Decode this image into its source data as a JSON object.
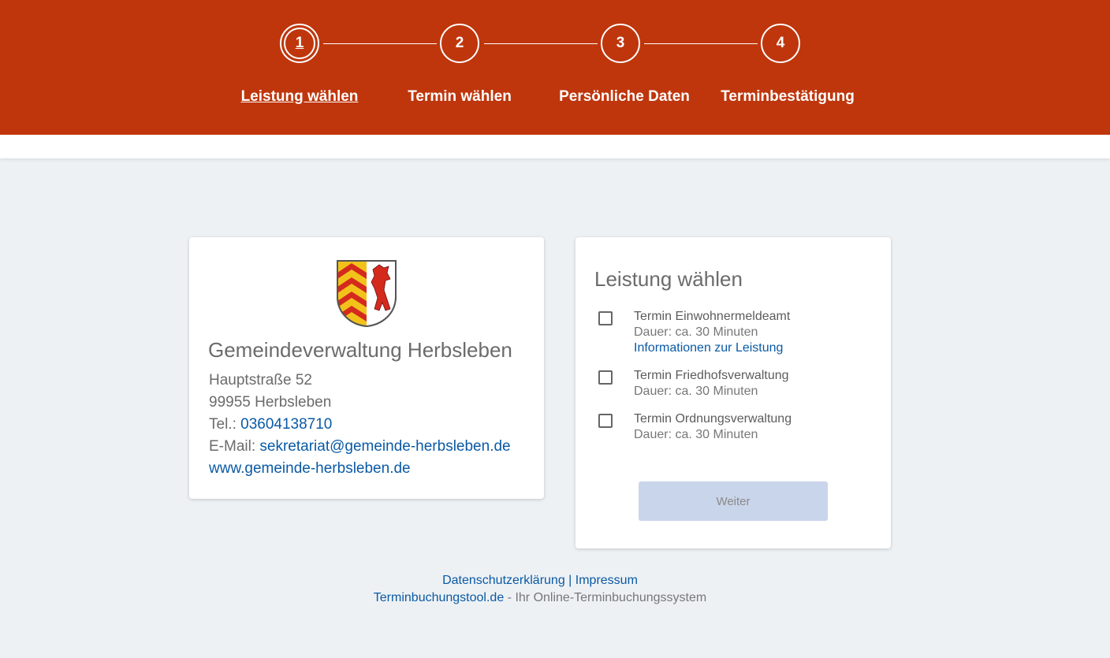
{
  "stepper": {
    "steps": [
      {
        "number": "1",
        "label": "Leistung wählen",
        "active": true
      },
      {
        "number": "2",
        "label": "Termin wählen",
        "active": false
      },
      {
        "number": "3",
        "label": "Persönliche Daten",
        "active": false
      },
      {
        "number": "4",
        "label": "Terminbestätigung",
        "active": false
      }
    ]
  },
  "organization": {
    "crest_icon": "coat-of-arms-icon",
    "name": "Gemeindeverwaltung Herbsleben",
    "street": "Hauptstraße 52",
    "city": "99955 Herbsleben",
    "phone_label": "Tel.:",
    "phone": "03604138710",
    "email_label": "E-Mail:",
    "email": "sekretariat@gemeinde-herbsleben.de",
    "website": "www.gemeinde-herbsleben.de"
  },
  "services_panel": {
    "title": "Leistung wählen",
    "services": [
      {
        "name": "Termin Einwohnermeldeamt",
        "duration": "Dauer: ca. 30 Minuten",
        "info_link": "Informationen zur Leistung",
        "checked": false
      },
      {
        "name": "Termin Friedhofsverwaltung",
        "duration": "Dauer: ca. 30 Minuten",
        "checked": false
      },
      {
        "name": "Termin Ordnungsverwaltung",
        "duration": "Dauer: ca. 30 Minuten",
        "checked": false
      }
    ],
    "next_button": "Weiter"
  },
  "footer": {
    "privacy": "Datenschutzerklärung",
    "separator": "|",
    "imprint": "Impressum",
    "brand": "Terminbuchungstool.de",
    "tagline": "- Ihr Online-Terminbuchungssystem"
  },
  "colors": {
    "header": "#bf360c",
    "link": "#0a5aa5",
    "button_disabled": "#c9d5ea",
    "background": "#eef1f4"
  }
}
